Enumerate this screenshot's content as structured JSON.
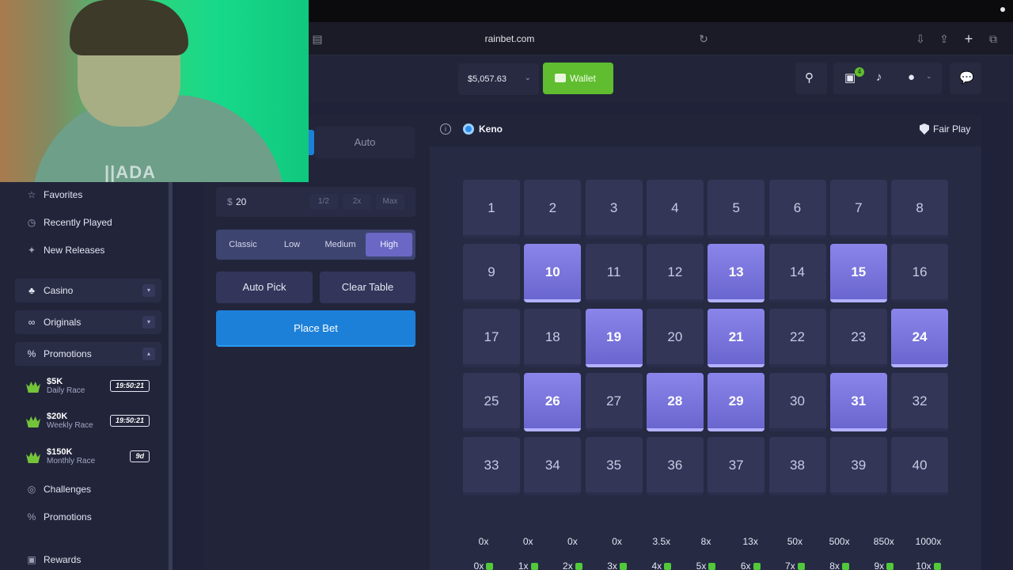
{
  "browser": {
    "url": "rainbet.com"
  },
  "webcam": {
    "shirt_text": "||ADA"
  },
  "header": {
    "balance": "$5,057.63",
    "wallet_label": "Wallet",
    "gift_count": "4"
  },
  "sidebar": {
    "items_top": [
      {
        "label": "Favorites"
      },
      {
        "label": "Recently Played"
      },
      {
        "label": "New Releases"
      }
    ],
    "groups": [
      {
        "label": "Casino",
        "chevron": "▾"
      },
      {
        "label": "Originals",
        "chevron": "▾"
      },
      {
        "label": "Promotions",
        "chevron": "▴"
      }
    ],
    "races": [
      {
        "amount": "$5K",
        "name": "Daily Race",
        "timer": "19:50:21"
      },
      {
        "amount": "$20K",
        "name": "Weekly Race",
        "timer": "19:50:21"
      },
      {
        "amount": "$150K",
        "name": "Monthly Race",
        "timer": "9d"
      }
    ],
    "items_bottom": [
      {
        "label": "Challenges"
      },
      {
        "label": "Promotions"
      },
      {
        "label": "Rewards"
      }
    ]
  },
  "controls": {
    "mode_auto": "Auto",
    "bet_currency": "$",
    "bet_amount": "20",
    "bet_half": "1/2",
    "bet_double": "2x",
    "bet_max": "Max",
    "risk_levels": [
      "Classic",
      "Low",
      "Medium",
      "High"
    ],
    "risk_selected": "High",
    "auto_pick": "Auto Pick",
    "clear_table": "Clear Table",
    "place_bet": "Place Bet"
  },
  "game": {
    "title": "Keno",
    "fair_play": "Fair Play",
    "selected_numbers": [
      10,
      13,
      15,
      19,
      21,
      24,
      26,
      28,
      29,
      31
    ],
    "tiles": [
      "1",
      "2",
      "3",
      "4",
      "5",
      "6",
      "7",
      "8",
      "9",
      "10",
      "11",
      "12",
      "13",
      "14",
      "15",
      "16",
      "17",
      "18",
      "19",
      "20",
      "21",
      "22",
      "23",
      "24",
      "25",
      "26",
      "27",
      "28",
      "29",
      "30",
      "31",
      "32",
      "33",
      "34",
      "35",
      "36",
      "37",
      "38",
      "39",
      "40"
    ],
    "payouts": [
      "0x",
      "0x",
      "0x",
      "0x",
      "3.5x",
      "8x",
      "13x",
      "50x",
      "500x",
      "850x",
      "1000x"
    ],
    "hits": [
      "0x",
      "1x",
      "2x",
      "3x",
      "4x",
      "5x",
      "6x",
      "7x",
      "8x",
      "9x",
      "10x"
    ],
    "colors": {
      "selected_tile": "#7f7ae0",
      "accent_blue": "#1d80d8",
      "accent_green": "#5fbd2f"
    }
  }
}
